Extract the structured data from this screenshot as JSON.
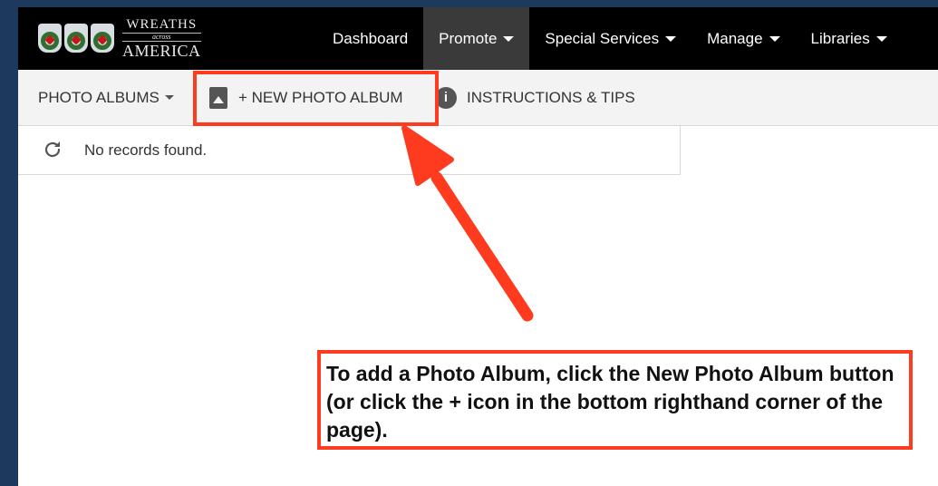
{
  "header": {
    "logo": {
      "line1": "WREATHS",
      "line2": "across",
      "line3": "AMERICA"
    },
    "nav": [
      {
        "label": "Dashboard",
        "dropdown": false,
        "active": false
      },
      {
        "label": "Promote",
        "dropdown": true,
        "active": true
      },
      {
        "label": "Special Services",
        "dropdown": true,
        "active": false
      },
      {
        "label": "Manage",
        "dropdown": true,
        "active": false
      },
      {
        "label": "Libraries",
        "dropdown": true,
        "active": false
      }
    ]
  },
  "toolbar": {
    "albums_label": "PHOTO ALBUMS",
    "new_album_label": "+ NEW PHOTO ALBUM",
    "instructions_label": "INSTRUCTIONS & TIPS"
  },
  "records": {
    "message": "No records found."
  },
  "annotation": {
    "callout_text": "To add a Photo Album, click the New Photo Album button (or click the + icon in the bottom righthand corner of the page).",
    "accent_color": "#ff3b1f"
  },
  "icons": [
    "wreath-logo-icon",
    "album-icon",
    "info-icon",
    "refresh-icon",
    "caret-down-icon"
  ],
  "colors": {
    "nav_bg": "#000000",
    "nav_active_bg": "#3a3a3a",
    "page_bg": "#1d3a5e"
  }
}
